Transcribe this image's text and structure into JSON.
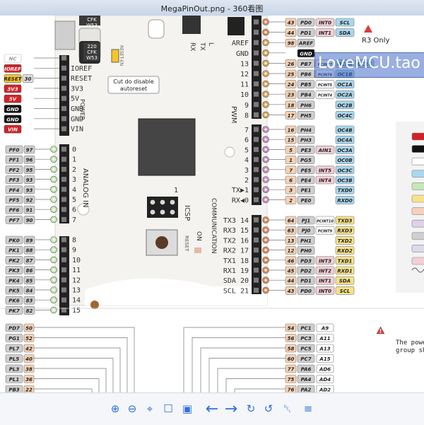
{
  "window": {
    "title": "MegaPinOut.png - 360看图"
  },
  "watermark": "LoveMCU.tao",
  "r3_note": "R3 Only",
  "power_warning": [
    "The powe",
    "group sh"
  ],
  "board": {
    "chips": [
      "CFK",
      "W53",
      "220",
      "CFK",
      "W53"
    ],
    "reset_en": "RESET-EN",
    "cut_note": [
      "Cut do disable",
      "autoreset"
    ],
    "header_top_right": [
      "AREF",
      "GND"
    ],
    "pwm_label": "PWM",
    "power_label": "POWER",
    "analog_label": "ANALOG IN",
    "comm_label": "COMMUNICATION",
    "icsp_label": "ICSP",
    "icsp_number": "1",
    "on_label": "ON",
    "reset_label": "RESET",
    "tx_label": "TX",
    "rx_label": "RX",
    "l_label": "L"
  },
  "power_pins": [
    {
      "label": "NC",
      "bg": "#ffffff",
      "fg": "#999999",
      "border": "#bbbbbb"
    },
    {
      "label": "IOREF",
      "bg": "#d42027",
      "fg": "#ffffff",
      "header": "IOREF"
    },
    {
      "label": "RESET",
      "bg": "#f7c623",
      "fg": "#222222",
      "num": "30",
      "header": "RESET"
    },
    {
      "label": "3V3",
      "bg": "#d42027",
      "fg": "#ffffff",
      "header": "3V3"
    },
    {
      "label": "5V",
      "bg": "#d42027",
      "fg": "#ffffff",
      "header": "5V"
    },
    {
      "label": "GND",
      "bg": "#111111",
      "fg": "#ffffff",
      "header": "GND"
    },
    {
      "label": "GND",
      "bg": "#111111",
      "fg": "#ffffff",
      "header": "GND"
    },
    {
      "label": "VIN",
      "bg": "#d42027",
      "fg": "#ffffff",
      "header": "VIN"
    }
  ],
  "analog_low": [
    {
      "port": "PF0",
      "num": "97",
      "idx": "0"
    },
    {
      "port": "PF1",
      "num": "96",
      "idx": "1"
    },
    {
      "port": "PF2",
      "num": "95",
      "idx": "2"
    },
    {
      "port": "PF3",
      "num": "93",
      "idx": "3"
    },
    {
      "port": "PF4",
      "num": "93",
      "idx": "4"
    },
    {
      "port": "PF5",
      "num": "92",
      "idx": "5"
    },
    {
      "port": "PF6",
      "num": "91",
      "idx": "6"
    },
    {
      "port": "PF7",
      "num": "90",
      "idx": "7"
    }
  ],
  "analog_high": [
    {
      "port": "PK0",
      "num": "89",
      "idx": "8"
    },
    {
      "port": "PK1",
      "num": "88",
      "idx": "9"
    },
    {
      "port": "PK2",
      "num": "87",
      "idx": "10"
    },
    {
      "port": "PK3",
      "num": "86",
      "idx": "11"
    },
    {
      "port": "PK4",
      "num": "85",
      "idx": "12"
    },
    {
      "port": "PK5",
      "num": "84",
      "idx": "13"
    },
    {
      "port": "PK6",
      "num": "83",
      "idx": "14"
    },
    {
      "port": "PK7",
      "num": "82",
      "idx": "15"
    }
  ],
  "digital_top": [
    {
      "num": "43",
      "port": "PD0",
      "f1": "INT0",
      "f2": "SCL",
      "board": ""
    },
    {
      "num": "44",
      "port": "PD1",
      "f1": "INT1",
      "f2": "SDA",
      "board": ""
    },
    {
      "num": "98",
      "port": "AREF",
      "f1": "",
      "f2": "",
      "board": "AREF"
    },
    {
      "num": "",
      "port": "GND",
      "f1": "",
      "f2": "",
      "board": "GND"
    },
    {
      "num": "26",
      "port": "PB7",
      "f1": "PCINT7",
      "f2": "OC0A",
      "f3": "OC1C",
      "board": "13"
    },
    {
      "num": "25",
      "port": "PB6",
      "f1": "PCINT6",
      "f2": "OC1B",
      "board": "12"
    },
    {
      "num": "24",
      "port": "PB5",
      "f1": "PCINT5",
      "f2": "OC1A",
      "board": "11"
    },
    {
      "num": "23",
      "port": "PB4",
      "f1": "PCINT4",
      "f2": "OC2A",
      "board": "10"
    },
    {
      "num": "18",
      "port": "PH6",
      "f1": "",
      "f2": "OC2B",
      "board": "9"
    },
    {
      "num": "17",
      "port": "PH5",
      "f1": "",
      "f2": "OC4C",
      "board": "8"
    }
  ],
  "digital_mid": [
    {
      "num": "16",
      "port": "PH4",
      "f1": "",
      "f2": "OC4B",
      "board": "7"
    },
    {
      "num": "15",
      "port": "PH3",
      "f1": "",
      "f2": "OC4A",
      "board": "6"
    },
    {
      "num": "5",
      "port": "PE3",
      "f1": "AIN1",
      "f2": "OC3A",
      "board": "5"
    },
    {
      "num": "1",
      "port": "PG5",
      "f1": "",
      "f2": "OC0B",
      "board": "4"
    },
    {
      "num": "7",
      "port": "PE5",
      "f1": "INT5",
      "f2": "OC3C",
      "board": "3"
    },
    {
      "num": "6",
      "port": "PE4",
      "f1": "INT4",
      "f2": "OC3B",
      "board": "2"
    },
    {
      "num": "3",
      "port": "PE1",
      "f1": "",
      "f2": "TXD0",
      "board": "TX▶1"
    },
    {
      "num": "2",
      "port": "PE0",
      "f1": "",
      "f2": "RXD0",
      "board": "RX◀0"
    }
  ],
  "comm": [
    {
      "num": "64",
      "port": "PJ1",
      "f1": "PCINT10",
      "f2": "TXD3",
      "board": "TX3 14"
    },
    {
      "num": "63",
      "port": "PJ0",
      "f1": "PCINT9",
      "f2": "RXD3",
      "board": "RX3 15"
    },
    {
      "num": "13",
      "port": "PH1",
      "f1": "",
      "f2": "TXD2",
      "board": "TX2 16"
    },
    {
      "num": "12",
      "port": "PH0",
      "f1": "",
      "f2": "RXD2",
      "board": "RX2 17"
    },
    {
      "num": "46",
      "port": "PD3",
      "f1": "INT3",
      "f2": "TXD1",
      "board": "TX1 18"
    },
    {
      "num": "45",
      "port": "PD2",
      "f1": "INT2",
      "f2": "RXD1",
      "board": "RX1 19"
    },
    {
      "num": "44",
      "port": "PD1",
      "f1": "INT1",
      "f2": "SDA",
      "board": "SDA 20"
    },
    {
      "num": "43",
      "port": "PD0",
      "f1": "INT0",
      "f2": "SCL",
      "board": "SCL 21"
    }
  ],
  "bottom_left": [
    {
      "port": "PD7",
      "num": "50"
    },
    {
      "port": "PG1",
      "num": "52"
    },
    {
      "port": "PL7",
      "num": "42"
    },
    {
      "port": "PL5",
      "num": "40"
    },
    {
      "port": "PL3",
      "num": "38"
    },
    {
      "port": "PL1",
      "num": "36"
    },
    {
      "port": "PB3",
      "num": "22"
    }
  ],
  "bottom_right": [
    {
      "num": "54",
      "port": "PC1",
      "sig": "A9"
    },
    {
      "num": "56",
      "port": "PC3",
      "sig": "A11"
    },
    {
      "num": "58",
      "port": "PC5",
      "sig": "A13"
    },
    {
      "num": "60",
      "port": "PC7",
      "sig": "A15"
    },
    {
      "num": "77",
      "port": "PA6",
      "sig": "AD6"
    },
    {
      "num": "75",
      "port": "PA4",
      "sig": "AD4"
    },
    {
      "num": "76",
      "port": "PA2",
      "sig": "AD2"
    }
  ],
  "legend_colors": [
    "#d42027",
    "#111111",
    "#ffffff",
    "#a9d7ef",
    "#c6e7b7",
    "#f7e28a",
    "#f6d1bb",
    "#e1d0ea",
    "#cfcfcf",
    "#dcd9e9",
    "#f4cfd6"
  ],
  "colors": {
    "power_red": "#d42027",
    "gnd_black": "#111111",
    "digital_orange": "#f6d2b5",
    "analog_green": "#c6e7b7",
    "port_gray": "#cfcfcf",
    "pcint_white": "#ffffff",
    "comm_yellow": "#f7e28a",
    "pwm_blue": "#a9d7ef"
  },
  "toolbar": [
    {
      "name": "zoom-in-icon",
      "glyph": "⊕"
    },
    {
      "name": "zoom-out-icon",
      "glyph": "⊖"
    },
    {
      "name": "fit-window-icon",
      "glyph": "⌖"
    },
    {
      "name": "open-folder-icon",
      "glyph": "☐"
    },
    {
      "name": "slideshow-icon",
      "glyph": "▣"
    },
    {
      "name": "previous-arrow-icon",
      "glyph": "←"
    },
    {
      "name": "next-arrow-icon",
      "glyph": "→"
    },
    {
      "name": "rotate-right-icon",
      "glyph": "↻"
    },
    {
      "name": "rotate-left-icon",
      "glyph": "↺"
    },
    {
      "name": "delete-icon",
      "glyph": "␡"
    },
    {
      "name": "menu-icon",
      "glyph": "≡"
    }
  ]
}
